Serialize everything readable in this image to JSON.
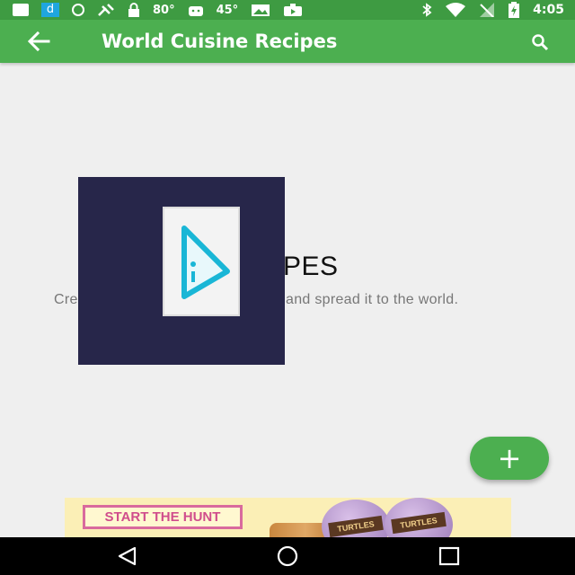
{
  "status_bar": {
    "temp_1": "80°",
    "temp_2": "45°",
    "time": "4:05",
    "icons": [
      "message-icon",
      "d-app-icon",
      "info-icon",
      "satellite-icon",
      "lock-icon",
      "android-icon",
      "photo-icon",
      "briefcase-icon",
      "bluetooth-icon",
      "wifi-icon",
      "signal-icon",
      "battery-charging-icon"
    ]
  },
  "app_bar": {
    "title": "World Cuisine Recipes",
    "back_icon": "arrow-back-icon",
    "search_icon": "search-icon"
  },
  "empty_state": {
    "heading": "ECIPES",
    "subtitle_start": "Cre",
    "subtitle_end": "and spread it to the world."
  },
  "fab": {
    "label": "+",
    "icon": "add-icon"
  },
  "ad": {
    "cta": "START THE HUNT",
    "brand": "TURTLES",
    "colors": {
      "background": "#fbefb6",
      "accent": "#d04d8c"
    }
  },
  "nav_bar": {
    "icons": [
      "back-triangle-icon",
      "home-circle-icon",
      "recents-square-icon"
    ]
  },
  "colors": {
    "primary": "#4caf50",
    "status_bar": "#3e9b42",
    "overlay": "#27264a",
    "logo": "#19b6d6"
  }
}
